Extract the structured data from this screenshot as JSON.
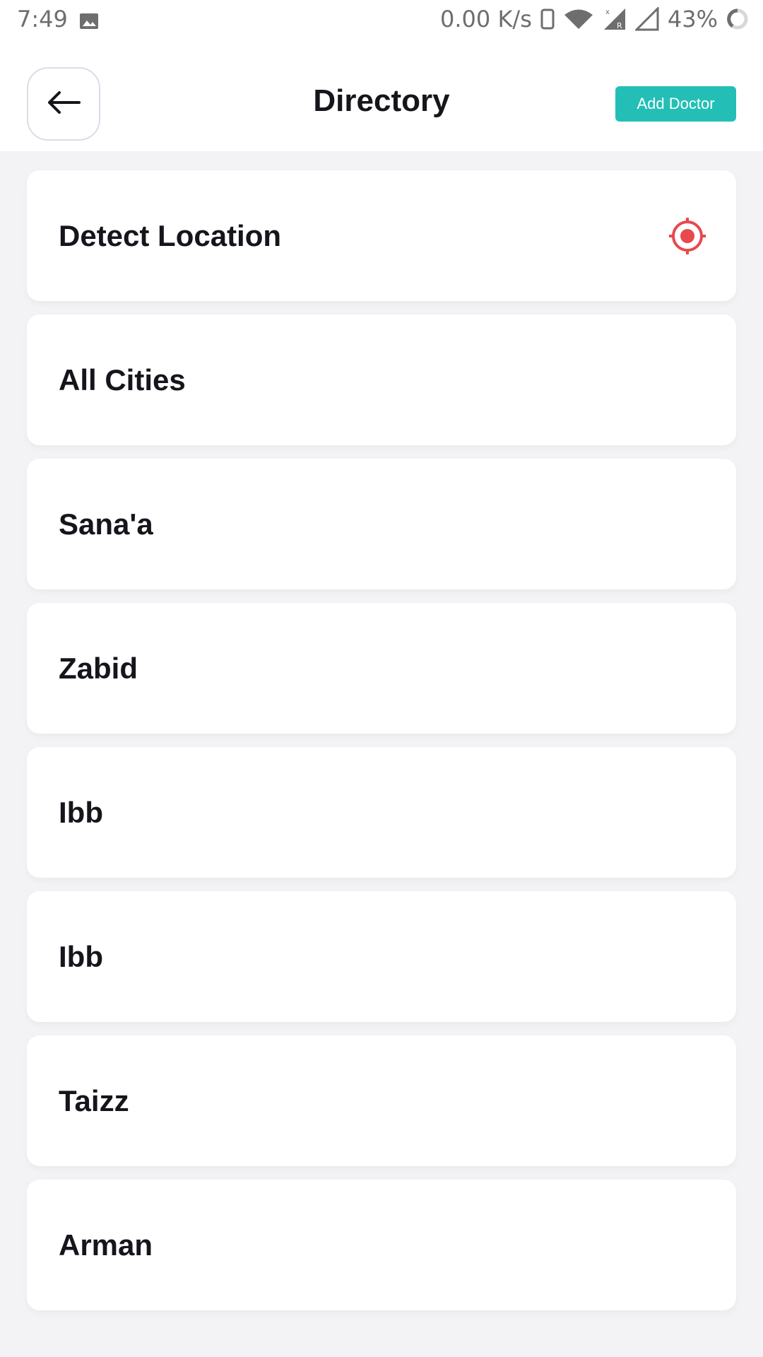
{
  "status_bar": {
    "time": "7:49",
    "network_speed": "0.00 K/s",
    "battery": "43%",
    "icons": [
      "gallery-icon",
      "phone-icon",
      "wifi-icon",
      "signal-icon",
      "signal-empty-icon",
      "battery-ring-icon"
    ]
  },
  "header": {
    "title": "Directory",
    "back_icon": "arrow-left-icon",
    "add_doctor_label": "Add Doctor",
    "accent_color": "#23bfb6"
  },
  "cities": {
    "detect_location": {
      "label": "Detect Location",
      "icon": "crosshair-target-icon",
      "icon_color": "#e8494d"
    },
    "items": [
      {
        "label": "All Cities"
      },
      {
        "label": "Sana'a"
      },
      {
        "label": "Zabid"
      },
      {
        "label": "Ibb"
      },
      {
        "label": "Ibb"
      },
      {
        "label": "Taizz"
      },
      {
        "label": "Arman"
      }
    ]
  }
}
